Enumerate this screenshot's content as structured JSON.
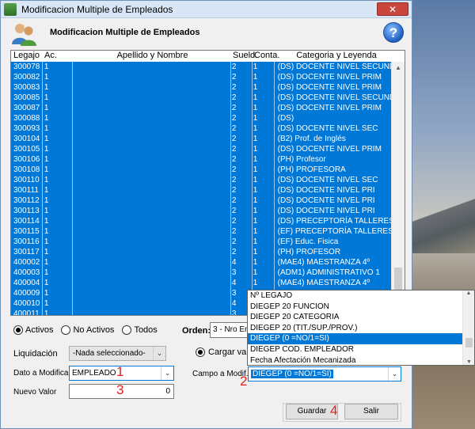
{
  "window": {
    "title": "Modificacion Multiple de Empleados",
    "close_symbol": "✕"
  },
  "header": {
    "heading": "Modificacion Multiple de Empleados",
    "help_symbol": "?"
  },
  "grid": {
    "columns": [
      "Legajo",
      "Ac.",
      "Apellido y Nombre",
      "Sueld.",
      "Conta.",
      "Categoria y Leyenda"
    ],
    "rows": [
      [
        "300078",
        "1",
        "",
        "2",
        "1",
        "(DS) DOCENTE NIVEL SECUND"
      ],
      [
        "300082",
        "1",
        "",
        "2",
        "1",
        "(DS) DOCENTE NIVEL PRIM"
      ],
      [
        "300083",
        "1",
        "",
        "2",
        "1",
        "(DS) DOCENTE NIVEL PRIM"
      ],
      [
        "300085",
        "1",
        "",
        "2",
        "1",
        "(DS) DOCENTE NIVEL SECUND"
      ],
      [
        "300087",
        "1",
        "",
        "2",
        "1",
        "(DS) DOCENTE NIVEL PRIM"
      ],
      [
        "300088",
        "1",
        "",
        "2",
        "1",
        "(DS)"
      ],
      [
        "300093",
        "1",
        "",
        "2",
        "1",
        "(DS) DOCENTE NIVEL SEC"
      ],
      [
        "300104",
        "1",
        "",
        "2",
        "1",
        "(B2) Prof. de Inglés"
      ],
      [
        "300105",
        "1",
        "",
        "2",
        "1",
        "(DS) DOCENTE NIVEL PRIM"
      ],
      [
        "300106",
        "1",
        "",
        "2",
        "1",
        "(PH) Profesor"
      ],
      [
        "300108",
        "1",
        "",
        "2",
        "1",
        "(PH) PROFESORA"
      ],
      [
        "300110",
        "1",
        "",
        "2",
        "1",
        "(DS) DOCENTE NIVEL SEC"
      ],
      [
        "300111",
        "1",
        "",
        "2",
        "1",
        "(DS) DOCENTE NIVEL PRI"
      ],
      [
        "300112",
        "1",
        "",
        "2",
        "1",
        "(DS) DOCENTE NIVEL PRI"
      ],
      [
        "300113",
        "1",
        "",
        "2",
        "1",
        "(DS) DOCENTE NIVEL PRI"
      ],
      [
        "300114",
        "1",
        "",
        "2",
        "1",
        "(DS) PRECEPTORÍA TALLERES"
      ],
      [
        "300115",
        "1",
        "",
        "2",
        "1",
        "(EF) PRECEPTORÍA TALLERES"
      ],
      [
        "300116",
        "1",
        "",
        "2",
        "1",
        "(EF) Educ. Fisica"
      ],
      [
        "300117",
        "1",
        "",
        "2",
        "1",
        "(PH) PROFESOR"
      ],
      [
        "400002",
        "1",
        "",
        "4",
        "1",
        "(MAE4) MAESTRANZA 4º"
      ],
      [
        "400003",
        "1",
        "",
        "3",
        "1",
        "(ADM1) ADMINISTRATIVO 1"
      ],
      [
        "400004",
        "1",
        "",
        "4",
        "1",
        "(MAE4) MAESTRANZA 4º"
      ],
      [
        "400009",
        "1",
        "",
        "3",
        "1",
        ""
      ],
      [
        "400010",
        "1",
        "",
        "4",
        "1",
        ""
      ],
      [
        "400011",
        "1",
        "",
        "3",
        "",
        ""
      ]
    ]
  },
  "filters": {
    "radios": [
      {
        "label": "Activos",
        "checked": true
      },
      {
        "label": "No Activos",
        "checked": false
      },
      {
        "label": "Todos",
        "checked": false
      }
    ],
    "orden_label": "Orden:",
    "orden_value": "3 - Nro Em"
  },
  "form": {
    "liquidacion_label": "Liquidación",
    "liquidacion_value": "-Nada seleccionado-",
    "cargar_label": "Cargar valo",
    "dato_label": "Dato a Modificar",
    "dato_value": "EMPLEADO",
    "campo_label": "Campo a Modif.",
    "campo_value": "DIEGEP (0 =NO/1=SI)",
    "nuevo_label": "Nuevo Valor",
    "nuevo_value": "0",
    "dropdown_options": [
      "Nº LEGAJO",
      "DIEGEP 20 FUNCION",
      "DIEGEP 20 CATEGORIA",
      "DIEGEP 20 (TIT./SUP./PROV.)",
      "DIEGEP (0 =NO/1=SI)",
      "DIEGEP COD. EMPLEADOR",
      "Fecha Afectación Mecanizada"
    ],
    "dropdown_selected_index": 4
  },
  "buttons": {
    "guardar": "Guardar",
    "salir": "Salir"
  },
  "annotations": [
    "1",
    "2",
    "3",
    "4"
  ]
}
